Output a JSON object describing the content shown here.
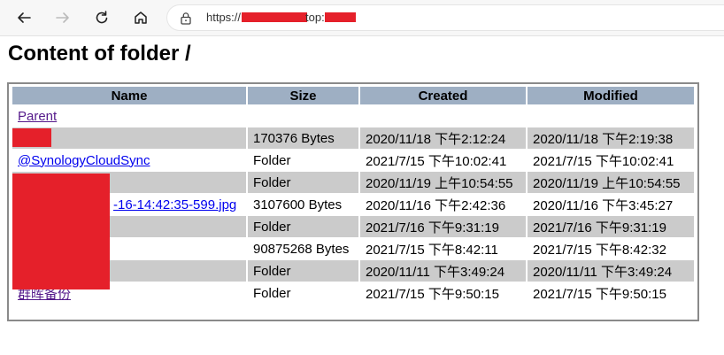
{
  "browser": {
    "url_prefix": "https://",
    "url_middle": "top:",
    "back_icon": "arrow-left-icon",
    "forward_icon": "arrow-right-icon",
    "reload_icon": "reload-icon",
    "home_icon": "home-icon",
    "lock_icon": "lock-icon"
  },
  "page": {
    "title": "Content of folder /"
  },
  "table": {
    "headers": [
      "Name",
      "Size",
      "Created",
      "Modified"
    ],
    "parent_label": "Parent",
    "rows": [
      {
        "name": "",
        "size": "170376 Bytes",
        "created": "2020/11/18 下午2:12:24",
        "modified": "2020/11/18 下午2:19:38"
      },
      {
        "name": "@SynologyCloudSync",
        "size": "Folder",
        "created": "2021/7/15 下午10:02:41",
        "modified": "2021/7/15 下午10:02:41"
      },
      {
        "name": "",
        "size": "Folder",
        "created": "2020/11/19 上午10:54:55",
        "modified": "2020/11/19 上午10:54:55"
      },
      {
        "name": "-16-14:42:35-599.jpg",
        "size": "3107600 Bytes",
        "created": "2020/11/16 下午2:42:36",
        "modified": "2020/11/16 下午3:45:27"
      },
      {
        "name": "",
        "size": "Folder",
        "created": "2021/7/16 下午9:31:19",
        "modified": "2021/7/16 下午9:31:19"
      },
      {
        "name": "",
        "size": "90875268 Bytes",
        "created": "2021/7/15 下午8:42:11",
        "modified": "2021/7/15 下午8:42:32"
      },
      {
        "name": "",
        "size": "Folder",
        "created": "2020/11/11 下午3:49:24",
        "modified": "2020/11/11 下午3:49:24"
      },
      {
        "name": "群晖备份",
        "size": "Folder",
        "created": "2021/7/15 下午9:50:15",
        "modified": "2021/7/15 下午9:50:15"
      }
    ]
  },
  "colors": {
    "header_bg": "#9eafc3",
    "shade_row_bg": "#cbcbcb",
    "redaction": "#e5202a",
    "link": "#0000ee",
    "visited_link": "#551a8b"
  }
}
